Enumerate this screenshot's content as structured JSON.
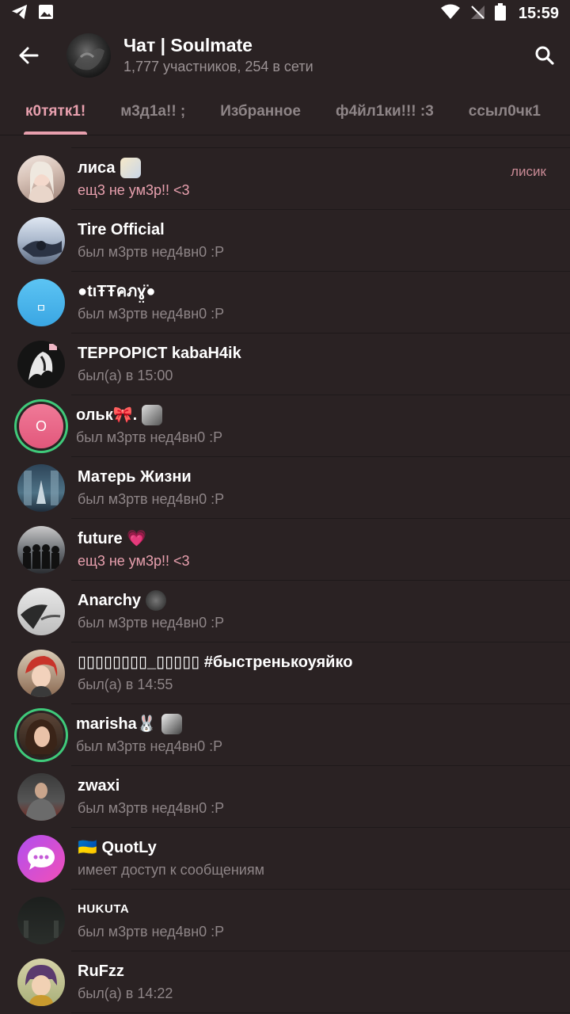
{
  "status_bar": {
    "time": "15:59"
  },
  "header": {
    "title": "Чат | Soulmate",
    "subtitle": "1,777 участников, 254 в сети"
  },
  "tabs": [
    {
      "label": "к0тятк1!",
      "active": true
    },
    {
      "label": "м3д1а!! ;",
      "active": false
    },
    {
      "label": "Избранное",
      "active": false
    },
    {
      "label": "ф4йл1ки!!! :3",
      "active": false
    },
    {
      "label": "ссыл0чк1",
      "active": false
    }
  ],
  "members": [
    {
      "name": "лиса",
      "status": "ещ3 не ум3р!! <3",
      "online": true,
      "badge": "лисик"
    },
    {
      "name": "Tire Official",
      "status": "был м3ртв нед4вн0 :P"
    },
    {
      "name": "●tιŦŦคภɣ̤̈●",
      "status": "был м3ртв нед4вн0 :P",
      "avatar_letter": "ㅁ"
    },
    {
      "name": "TEPPOPICT kabaH4ik",
      "status": "был(а) в 15:00"
    },
    {
      "name": "ольк🎀.",
      "status": "был м3ртв нед4вн0 :P",
      "avatar_letter": "O"
    },
    {
      "name": "Матерь Жизни",
      "status": "был м3ртв нед4вн0 :P"
    },
    {
      "name": "future 💗",
      "status": "ещ3 не ум3р!! <3",
      "online": true
    },
    {
      "name": "Anarchy",
      "status": "был м3ртв нед4вн0 :P"
    },
    {
      "name": "▯▯▯▯▯▯▯▯_▯▯▯▯▯ #быстренькоуяйко",
      "status": "был(а) в 14:55"
    },
    {
      "name": "marisha🐰",
      "status": "был м3ртв нед4вн0 :P"
    },
    {
      "name": "zwaxi",
      "status": "был м3ртв нед4вн0 :P"
    },
    {
      "name": "🇺🇦 QuotLy",
      "status": "имеет доступ к сообщениям"
    },
    {
      "name": "HUKUTA",
      "status": "был м3ртв нед4вн0 :P"
    },
    {
      "name": "RuFzz",
      "status": "был(а) в 14:22"
    }
  ],
  "colors": {
    "background": "#2a2223",
    "accent": "#e8a0ae",
    "secondary_text": "#8e8587",
    "story_ring": "#3fca7a"
  }
}
